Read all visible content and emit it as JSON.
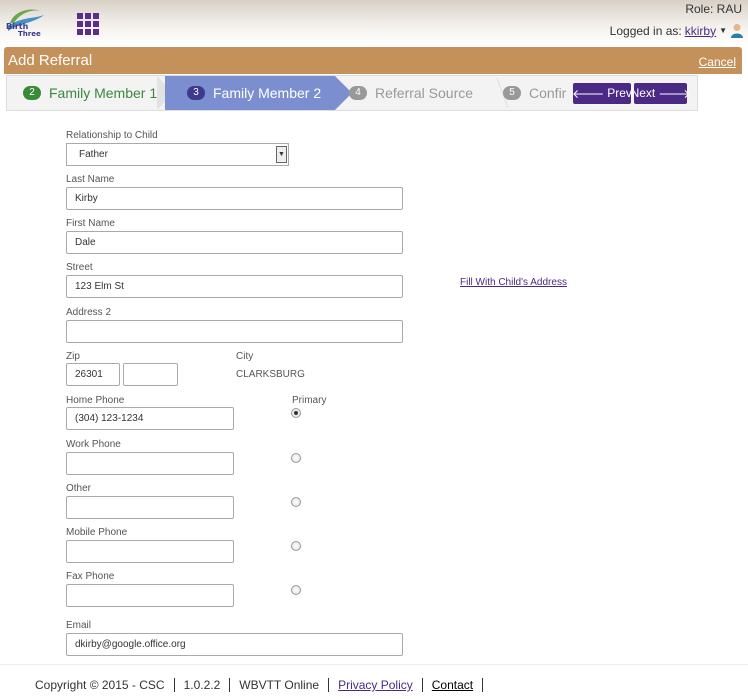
{
  "header": {
    "logo_alt": "Birth to Three",
    "role_text": "Role: RAU",
    "logged_in_label": "Logged in as:",
    "username": "kkirby"
  },
  "title_bar": {
    "title": "Add Referral",
    "cancel": "Cancel"
  },
  "wizard": {
    "steps": [
      {
        "num": "2",
        "label": "Family Member 1",
        "state": "complete"
      },
      {
        "num": "3",
        "label": "Family Member 2",
        "state": "active"
      },
      {
        "num": "4",
        "label": "Referral Source",
        "state": "pending"
      },
      {
        "num": "5",
        "label": "Confir",
        "state": "pending"
      }
    ],
    "prev": "Prev",
    "next": "Next"
  },
  "form": {
    "relationship_label": "Relationship to Child",
    "relationship_value": "Father",
    "last_name_label": "Last Name",
    "last_name_value": "Kirby",
    "first_name_label": "First Name",
    "first_name_value": "Dale",
    "street_label": "Street",
    "street_value": "123 Elm St",
    "fill_link": "Fill With Child's Address",
    "address2_label": "Address 2",
    "address2_value": "",
    "zip_label": "Zip",
    "zip_value": "26301",
    "zip_ext_value": "",
    "city_label": "City",
    "city_value": "CLARKSBURG",
    "home_phone_label": "Home Phone",
    "home_phone_value": "(304) 123-1234",
    "primary_label": "Primary",
    "work_phone_label": "Work Phone",
    "other_label": "Other",
    "mobile_phone_label": "Mobile Phone",
    "fax_phone_label": "Fax Phone",
    "email_label": "Email",
    "email_value": "dkirby@google.office.org",
    "primary_selected": "Home Phone"
  },
  "footer": {
    "copyright": "Copyright © 2015 - CSC",
    "version": "1.0.2.2",
    "app": "WBVTT Online",
    "privacy": "Privacy Policy",
    "contact": "Contact"
  },
  "colors": {
    "brand_purple": "#4b2a86",
    "title_bar": "#c4915a",
    "active_step": "#7b8fd0",
    "complete_step": "#3a8a3a"
  }
}
